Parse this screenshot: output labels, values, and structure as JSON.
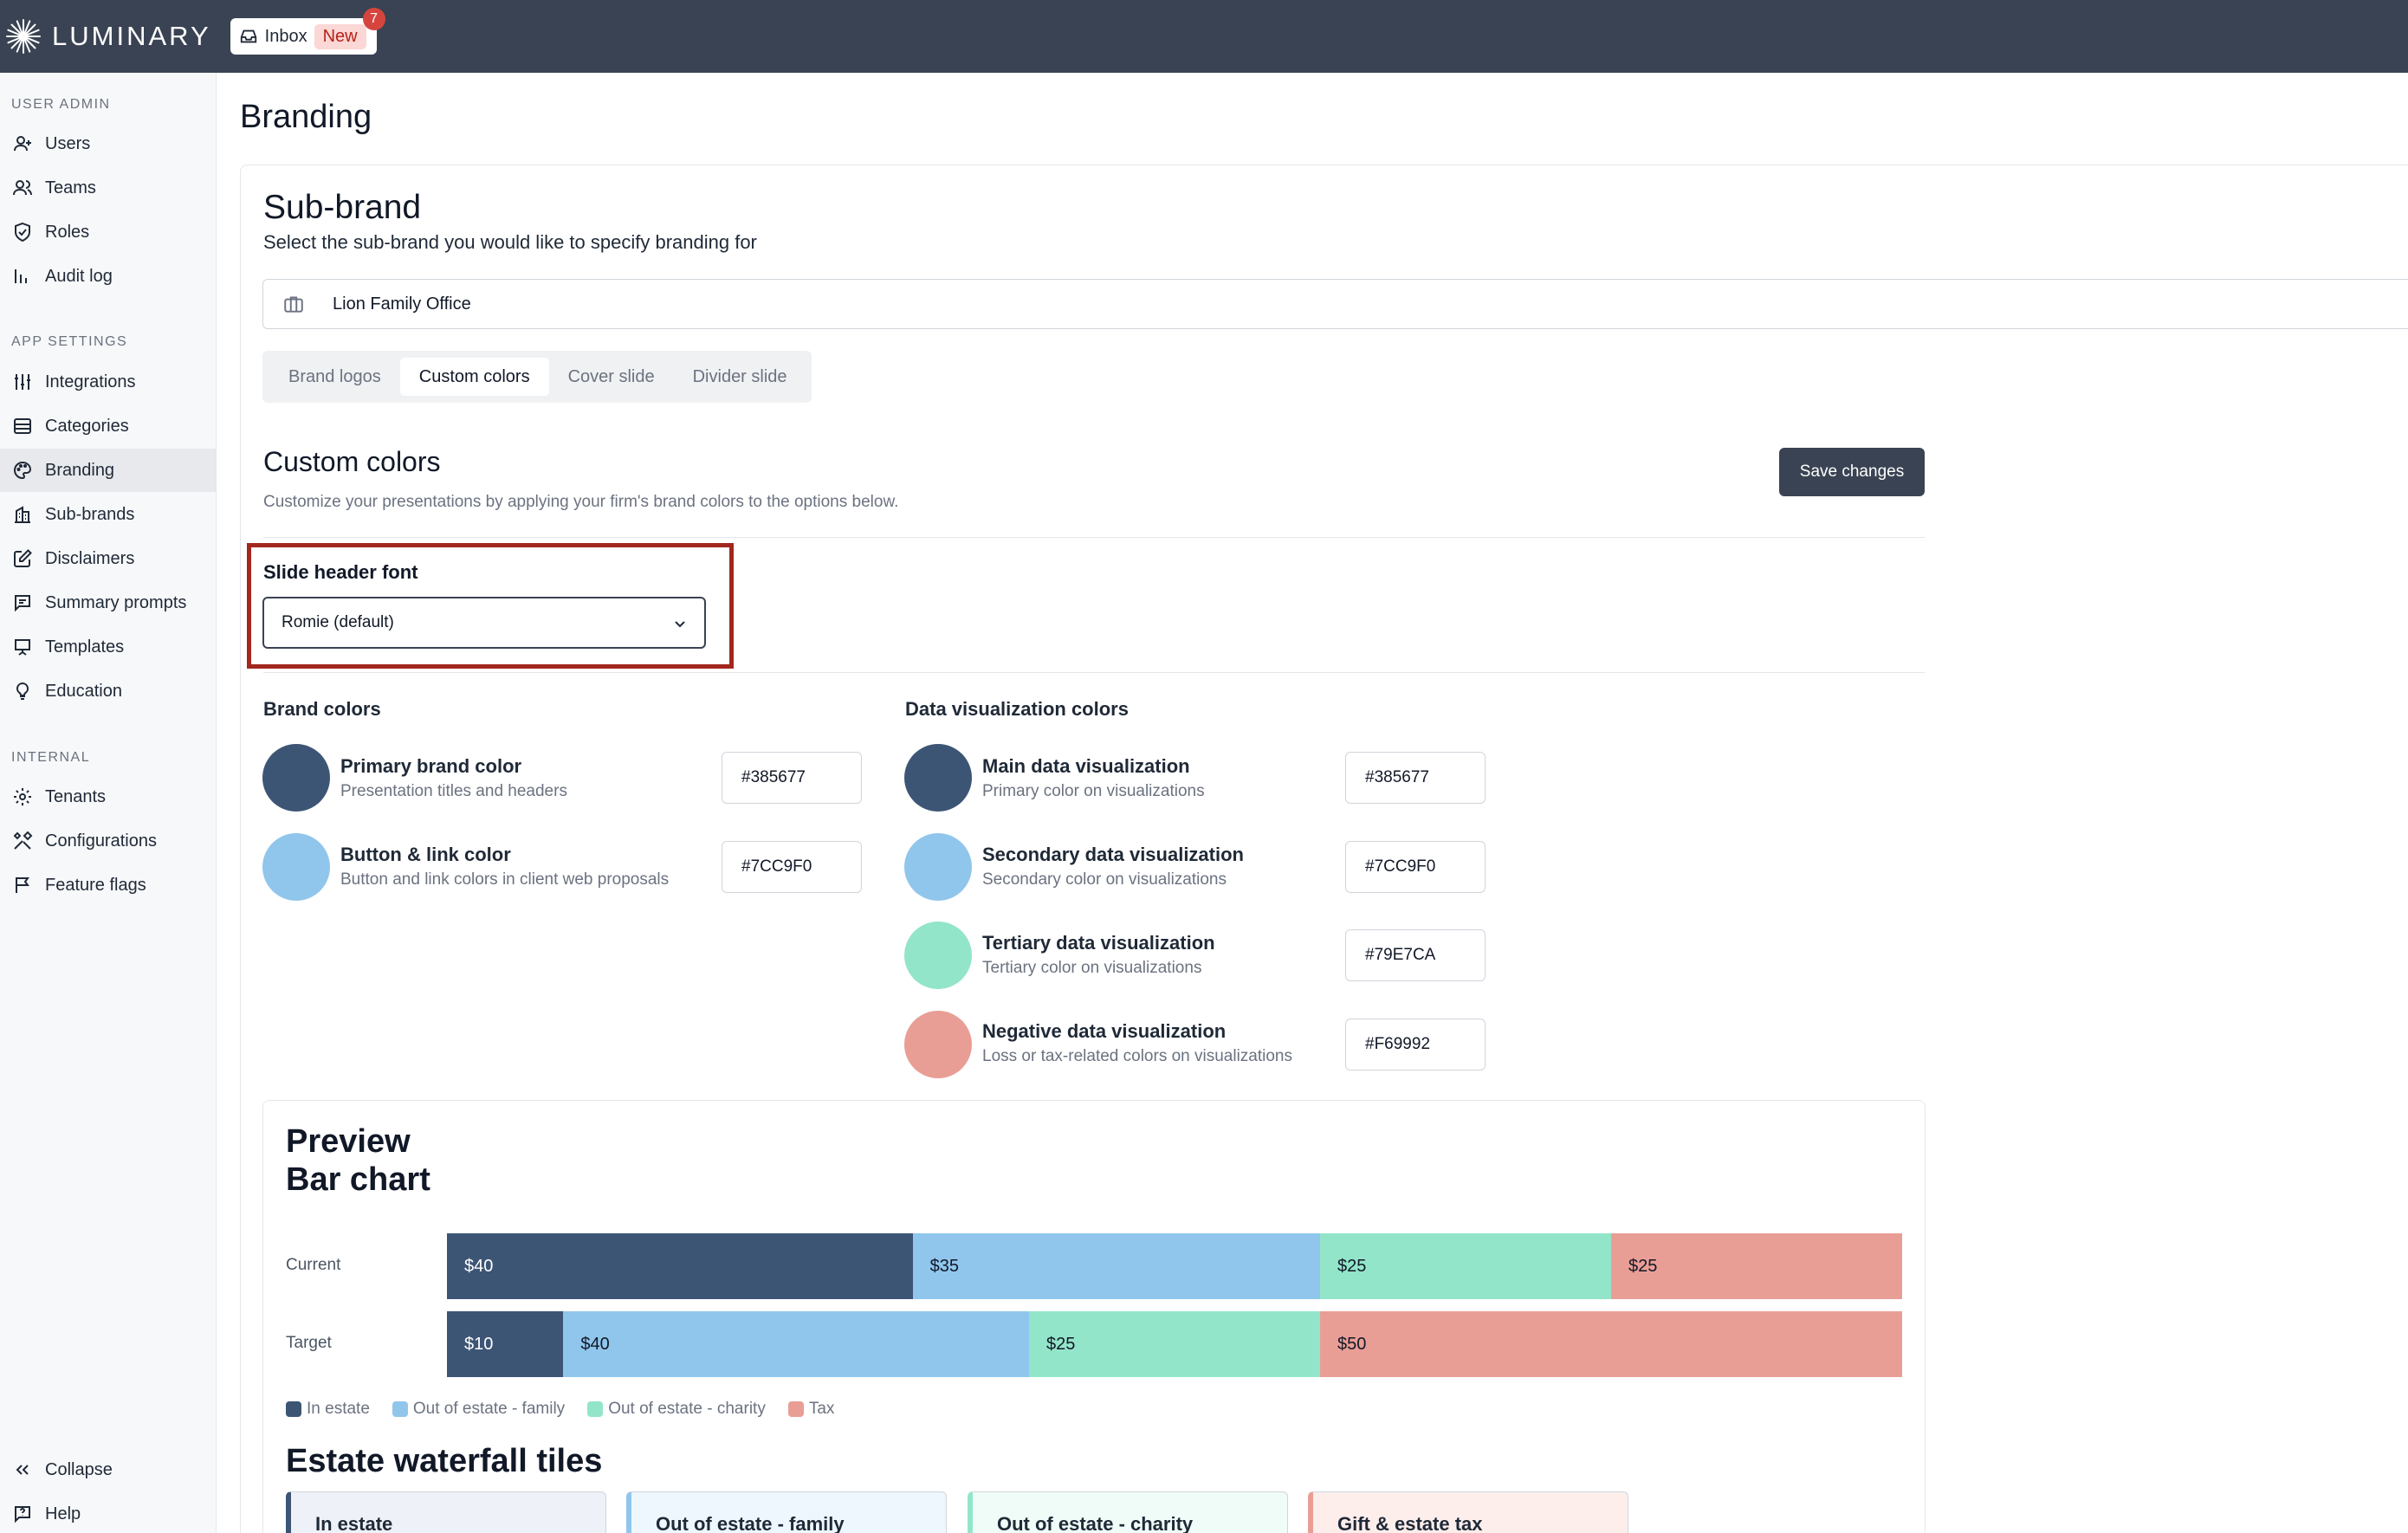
{
  "app": {
    "brand": "LUMINARY",
    "inbox_label": "Inbox",
    "inbox_new": "New",
    "inbox_count": "7"
  },
  "sidebar": {
    "sections": [
      "USER ADMIN",
      "APP SETTINGS",
      "INTERNAL"
    ],
    "user_admin": [
      {
        "label": "Users",
        "icon": "user-plus-icon"
      },
      {
        "label": "Teams",
        "icon": "users-icon"
      },
      {
        "label": "Roles",
        "icon": "shield-icon"
      },
      {
        "label": "Audit log",
        "icon": "bar-chart-icon"
      }
    ],
    "app_settings": [
      {
        "label": "Integrations",
        "icon": "sliders-icon"
      },
      {
        "label": "Categories",
        "icon": "layers-icon"
      },
      {
        "label": "Branding",
        "icon": "palette-icon",
        "active": true
      },
      {
        "label": "Sub-brands",
        "icon": "building-icon"
      },
      {
        "label": "Disclaimers",
        "icon": "edit-icon"
      },
      {
        "label": "Summary prompts",
        "icon": "message-icon"
      },
      {
        "label": "Templates",
        "icon": "presentation-icon"
      },
      {
        "label": "Education",
        "icon": "lightbulb-icon"
      }
    ],
    "internal": [
      {
        "label": "Tenants",
        "icon": "gear-icon"
      },
      {
        "label": "Configurations",
        "icon": "tools-icon"
      },
      {
        "label": "Feature flags",
        "icon": "flag-icon"
      }
    ],
    "footer": [
      {
        "label": "Collapse",
        "icon": "chevrons-left-icon"
      },
      {
        "label": "Help",
        "icon": "help-icon"
      }
    ]
  },
  "page": {
    "title": "Branding",
    "subbrand_heading": "Sub-brand",
    "subbrand_desc": "Select the sub-brand you would like to specify branding for",
    "subbrand_value": "Lion Family Office",
    "tabs": [
      {
        "label": "Brand logos"
      },
      {
        "label": "Custom colors",
        "active": true
      },
      {
        "label": "Cover slide"
      },
      {
        "label": "Divider slide"
      }
    ],
    "custom_colors_heading": "Custom colors",
    "custom_colors_desc": "Customize your presentations by applying your firm's brand colors to the options below.",
    "save_label": "Save changes",
    "font_label": "Slide header font",
    "font_value": "Romie (default)"
  },
  "brand_colors": {
    "title": "Brand colors",
    "items": [
      {
        "name": "Primary brand color",
        "desc": "Presentation titles and headers",
        "hex": "#385677",
        "swatch": "#3d5575"
      },
      {
        "name": "Button & link color",
        "desc": "Button and link colors in client web proposals",
        "hex": "#7CC9F0",
        "swatch": "#90c6ec"
      }
    ]
  },
  "dataviz_colors": {
    "title": "Data visualization colors",
    "items": [
      {
        "name": "Main data visualization",
        "desc": "Primary color on visualizations",
        "hex": "#385677",
        "swatch": "#3d5575"
      },
      {
        "name": "Secondary data visualization",
        "desc": "Secondary color on visualizations",
        "hex": "#7CC9F0",
        "swatch": "#90c6ec"
      },
      {
        "name": "Tertiary data visualization",
        "desc": "Tertiary color on visualizations",
        "hex": "#79E7CA",
        "swatch": "#93e5c9"
      },
      {
        "name": "Negative data visualization",
        "desc": "Loss or tax-related colors on visualizations",
        "hex": "#F69992",
        "swatch": "#e99e95"
      }
    ]
  },
  "preview": {
    "title_line1": "Preview",
    "title_line2": "Bar chart",
    "waterfall_title": "Estate waterfall tiles",
    "tiles": [
      {
        "label": "In estate",
        "color": "#3d5575",
        "bg": "#eef2f8"
      },
      {
        "label": "Out of estate - family",
        "color": "#90c6ec",
        "bg": "#eef7fd"
      },
      {
        "label": "Out of estate - charity",
        "color": "#93e5c9",
        "bg": "#effcf7"
      },
      {
        "label": "Gift & estate tax",
        "color": "#e99e95",
        "bg": "#fdeeec"
      }
    ]
  },
  "chart_data": {
    "type": "bar",
    "orientation": "horizontal-stacked",
    "categories": [
      "Current",
      "Target"
    ],
    "series": [
      {
        "name": "In estate",
        "color": "#3d5575",
        "values": [
          40,
          10
        ],
        "labels": [
          "$40",
          "$10"
        ]
      },
      {
        "name": "Out of estate - family",
        "color": "#90c6ec",
        "values": [
          35,
          40
        ],
        "labels": [
          "$35",
          "$40"
        ]
      },
      {
        "name": "Out of estate - charity",
        "color": "#93e5c9",
        "values": [
          25,
          25
        ],
        "labels": [
          "$25",
          "$25"
        ]
      },
      {
        "name": "Tax",
        "color": "#e99e95",
        "values": [
          25,
          50
        ],
        "labels": [
          "$25",
          "$50"
        ]
      }
    ],
    "legend": "bottom-left"
  }
}
